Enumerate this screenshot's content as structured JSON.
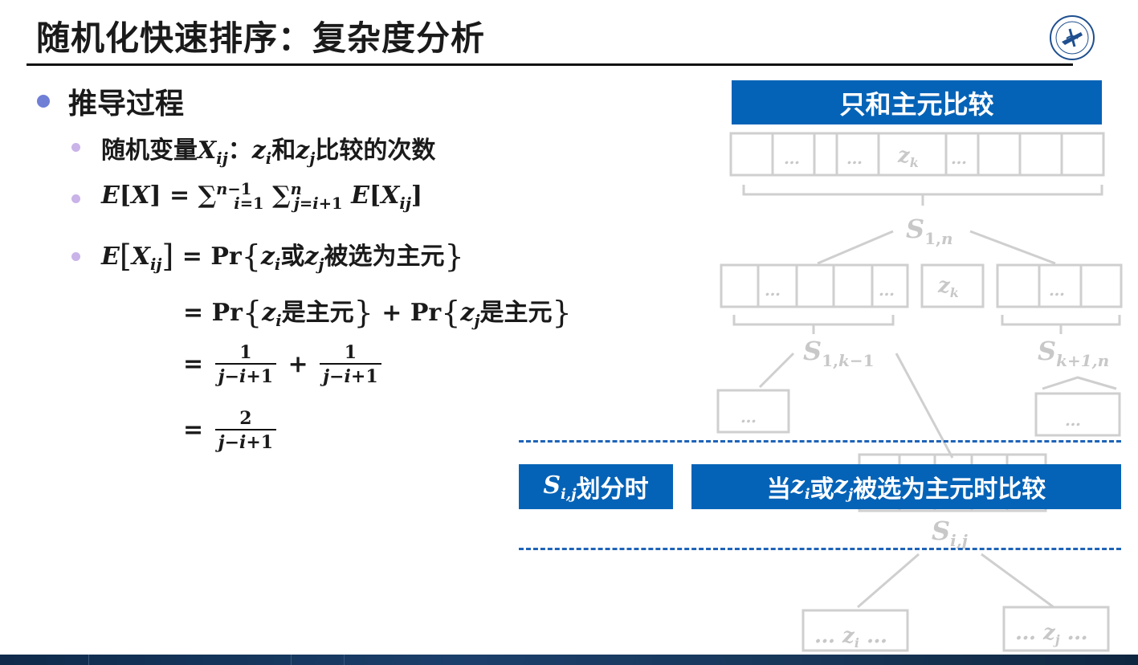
{
  "title": "随机化快速排序：复杂度分析",
  "section": "推导过程",
  "items": {
    "var_prefix": "随机变量",
    "var_suffix": "比较的次数",
    "or": "或",
    "selected": "被选为主元",
    "is_pivot": "是主元",
    "and": "和",
    "pr": "Pr"
  },
  "diagram": {
    "top_label": "只和主元比较",
    "ellipsis": "…",
    "mid_label_right": "当",
    "mid_label_right_end": "被选为主元时比较",
    "split_label_suffix": "划分时",
    "zk": "z",
    "zk_sub": "k"
  },
  "colors": {
    "banner": "#0563b7",
    "dash": "#1e63b8",
    "faded": "#c8c8c8",
    "bullet1": "#6f7fd6",
    "bullet2": "#c9b3e8"
  }
}
